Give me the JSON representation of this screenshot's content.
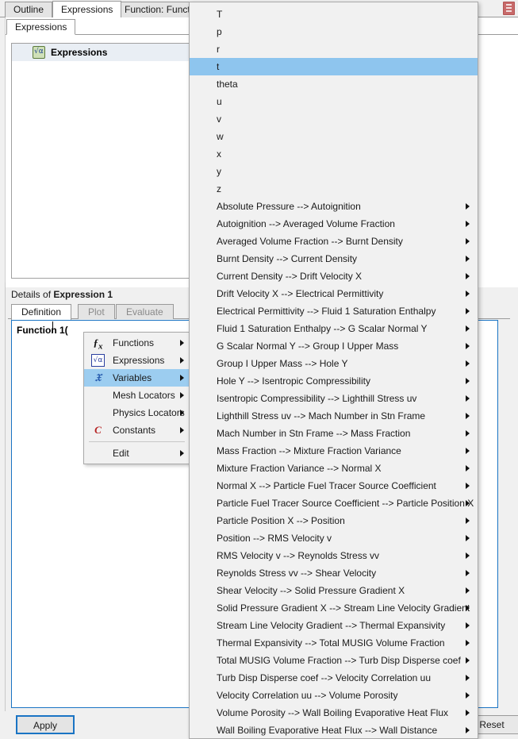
{
  "window": {
    "outer_tabs": [
      {
        "label": "Outline",
        "active": false
      },
      {
        "label": "Expressions",
        "active": true
      },
      {
        "label": "Function: Function",
        "active": false
      }
    ],
    "top_right_icon": "stop-icon"
  },
  "expressions_page": {
    "inner_tab": "Expressions",
    "tree": {
      "root_label": "Expressions",
      "root_icon": "expressions-folder-icon"
    }
  },
  "details": {
    "title_prefix": "Details of ",
    "title_target": "Expression 1",
    "tabs": [
      {
        "label": "Definition",
        "active": true,
        "enabled": true
      },
      {
        "label": "Plot",
        "active": false,
        "enabled": false
      },
      {
        "label": "Evaluate",
        "active": false,
        "enabled": false
      }
    ],
    "editor_value": "Function 1(",
    "apply_label": "Apply",
    "reset_label": "Reset"
  },
  "context_menu": {
    "items": [
      {
        "label": "Functions",
        "icon": "function-fx-icon",
        "has_submenu": true,
        "selected": false
      },
      {
        "label": "Expressions",
        "icon": "expression-sqrt-alpha-icon",
        "has_submenu": true,
        "selected": false
      },
      {
        "label": "Variables",
        "icon": "variables-icon",
        "has_submenu": true,
        "selected": true
      },
      {
        "label": "Mesh Locators",
        "icon": "",
        "has_submenu": true,
        "selected": false
      },
      {
        "label": "Physics Locators",
        "icon": "",
        "has_submenu": true,
        "selected": false
      },
      {
        "label": "Constants",
        "icon": "constant-c-icon",
        "has_submenu": true,
        "selected": false
      },
      {
        "separator": true
      },
      {
        "label": "Edit",
        "icon": "",
        "has_submenu": true,
        "selected": false
      }
    ]
  },
  "variables_menu": {
    "items": [
      {
        "label": "T",
        "has_submenu": false,
        "selected": false
      },
      {
        "label": "p",
        "has_submenu": false,
        "selected": false
      },
      {
        "label": "r",
        "has_submenu": false,
        "selected": false
      },
      {
        "label": "t",
        "has_submenu": false,
        "selected": true
      },
      {
        "label": "theta",
        "has_submenu": false,
        "selected": false
      },
      {
        "label": "u",
        "has_submenu": false,
        "selected": false
      },
      {
        "label": "v",
        "has_submenu": false,
        "selected": false
      },
      {
        "label": "w",
        "has_submenu": false,
        "selected": false
      },
      {
        "label": "x",
        "has_submenu": false,
        "selected": false
      },
      {
        "label": "y",
        "has_submenu": false,
        "selected": false
      },
      {
        "label": "z",
        "has_submenu": false,
        "selected": false
      },
      {
        "label": "Absolute Pressure  -->  Autoignition",
        "has_submenu": true,
        "selected": false
      },
      {
        "label": "Autoignition  -->  Averaged Volume Fraction",
        "has_submenu": true,
        "selected": false
      },
      {
        "label": "Averaged Volume Fraction  -->  Burnt Density",
        "has_submenu": true,
        "selected": false
      },
      {
        "label": "Burnt Density  -->  Current Density",
        "has_submenu": true,
        "selected": false
      },
      {
        "label": "Current Density  -->  Drift Velocity X",
        "has_submenu": true,
        "selected": false
      },
      {
        "label": "Drift Velocity X  -->  Electrical Permittivity",
        "has_submenu": true,
        "selected": false
      },
      {
        "label": "Electrical Permittivity  -->  Fluid 1 Saturation Enthalpy",
        "has_submenu": true,
        "selected": false
      },
      {
        "label": "Fluid 1 Saturation Enthalpy  -->  G Scalar Normal Y",
        "has_submenu": true,
        "selected": false
      },
      {
        "label": "G Scalar Normal Y  -->  Group I Upper Mass",
        "has_submenu": true,
        "selected": false
      },
      {
        "label": "Group I Upper Mass  -->  Hole Y",
        "has_submenu": true,
        "selected": false
      },
      {
        "label": "Hole Y  -->  Isentropic Compressibility",
        "has_submenu": true,
        "selected": false
      },
      {
        "label": "Isentropic Compressibility  -->  Lighthill Stress uv",
        "has_submenu": true,
        "selected": false
      },
      {
        "label": "Lighthill Stress uv  -->  Mach Number in Stn Frame",
        "has_submenu": true,
        "selected": false
      },
      {
        "label": "Mach Number in Stn Frame  -->  Mass Fraction",
        "has_submenu": true,
        "selected": false
      },
      {
        "label": "Mass Fraction  -->  Mixture Fraction Variance",
        "has_submenu": true,
        "selected": false
      },
      {
        "label": "Mixture Fraction Variance  -->  Normal X",
        "has_submenu": true,
        "selected": false
      },
      {
        "label": "Normal X  -->  Particle Fuel Tracer Source Coefficient",
        "has_submenu": true,
        "selected": false
      },
      {
        "label": "Particle Fuel Tracer Source Coefficient  -->  Particle Position X",
        "has_submenu": true,
        "selected": false
      },
      {
        "label": "Particle Position X  -->  Position",
        "has_submenu": true,
        "selected": false
      },
      {
        "label": "Position  -->  RMS Velocity v",
        "has_submenu": true,
        "selected": false
      },
      {
        "label": "RMS Velocity v  -->  Reynolds Stress vv",
        "has_submenu": true,
        "selected": false
      },
      {
        "label": "Reynolds Stress vv  -->  Shear Velocity",
        "has_submenu": true,
        "selected": false
      },
      {
        "label": "Shear Velocity  -->  Solid Pressure Gradient X",
        "has_submenu": true,
        "selected": false
      },
      {
        "label": "Solid Pressure Gradient X  -->  Stream Line Velocity Gradient",
        "has_submenu": true,
        "selected": false
      },
      {
        "label": "Stream Line Velocity Gradient  -->  Thermal Expansivity",
        "has_submenu": true,
        "selected": false
      },
      {
        "label": "Thermal Expansivity  -->  Total MUSIG Volume Fraction",
        "has_submenu": true,
        "selected": false
      },
      {
        "label": "Total MUSIG Volume Fraction  -->  Turb Disp Disperse coef",
        "has_submenu": true,
        "selected": false
      },
      {
        "label": "Turb Disp Disperse coef  -->  Velocity Correlation uu",
        "has_submenu": true,
        "selected": false
      },
      {
        "label": "Velocity Correlation uu  -->  Volume Porosity",
        "has_submenu": true,
        "selected": false
      },
      {
        "label": "Volume Porosity  -->  Wall Boiling Evaporative Heat Flux",
        "has_submenu": true,
        "selected": false
      },
      {
        "label": "Wall Boiling Evaporative Heat Flux  -->  Wall Distance",
        "has_submenu": true,
        "selected": false
      }
    ]
  },
  "colors": {
    "selection": "#8ec5ee",
    "menu_bg": "#f1f1f1",
    "accent": "#1a74c4"
  }
}
